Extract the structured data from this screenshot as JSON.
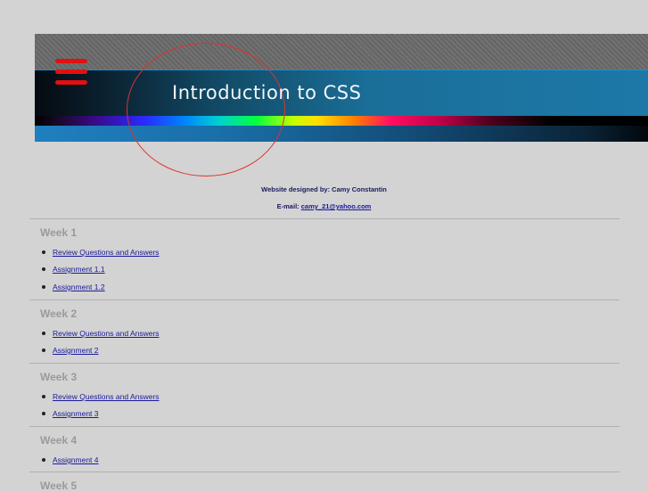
{
  "banner": {
    "title": "Introduction to CSS",
    "icon": "menu-icon",
    "accent_color": "#1d78a8",
    "ring_color": "#e03030",
    "menu_color": "#e21010"
  },
  "credits": {
    "designer_text": "Website designed by: Camy Constantin",
    "email_label": "E-mail: ",
    "email_link": "camy_21@yahoo.com"
  },
  "weeks": [
    {
      "title": "Week 1",
      "links": [
        "Review Questions and Answers",
        "Assignment 1.1",
        "Assignment 1.2"
      ]
    },
    {
      "title": "Week 2",
      "links": [
        "Review Questions and Answers",
        "Assignment 2"
      ]
    },
    {
      "title": "Week 3",
      "links": [
        "Review Questions and Answers",
        "Assignment 3"
      ]
    },
    {
      "title": "Week 4",
      "links": [
        "Assignment 4"
      ]
    },
    {
      "title": "Week 5",
      "links": []
    }
  ]
}
